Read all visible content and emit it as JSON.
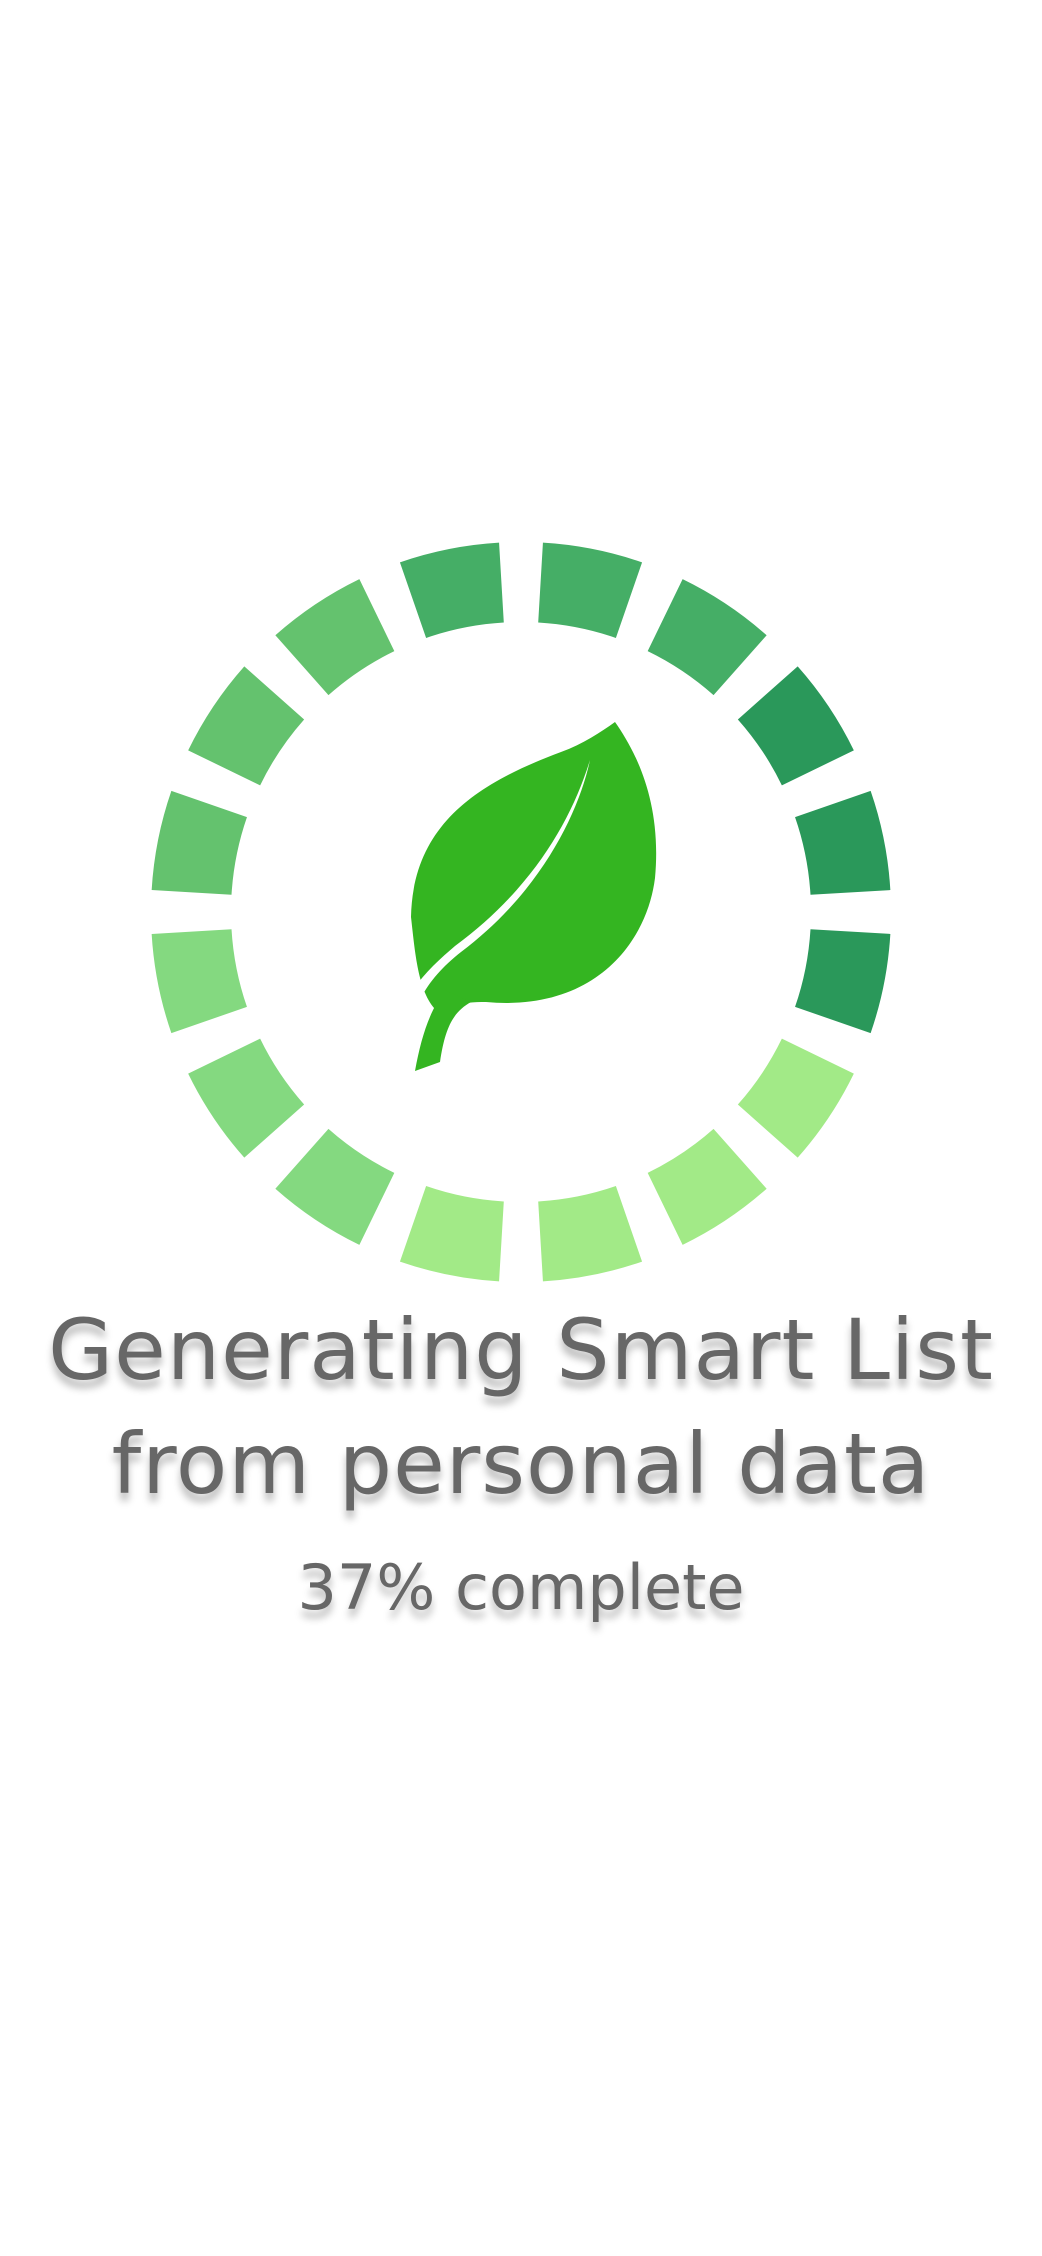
{
  "loader": {
    "title_line_1": "Generating Smart List",
    "title_line_2": "from personal data",
    "progress_percent": 37,
    "progress_label": "37% complete",
    "icon": "leaf-icon",
    "segment_colors": [
      "#45ae66",
      "#45ae66",
      "#2a985a",
      "#2a985a",
      "#2a985a",
      "#a2ea87",
      "#a2ea87",
      "#a2ea87",
      "#a2ea87",
      "#84d980",
      "#84d980",
      "#84d980",
      "#64c26e",
      "#64c26e",
      "#64c26e",
      "#45ae66"
    ],
    "leaf_color": "#34b521"
  }
}
